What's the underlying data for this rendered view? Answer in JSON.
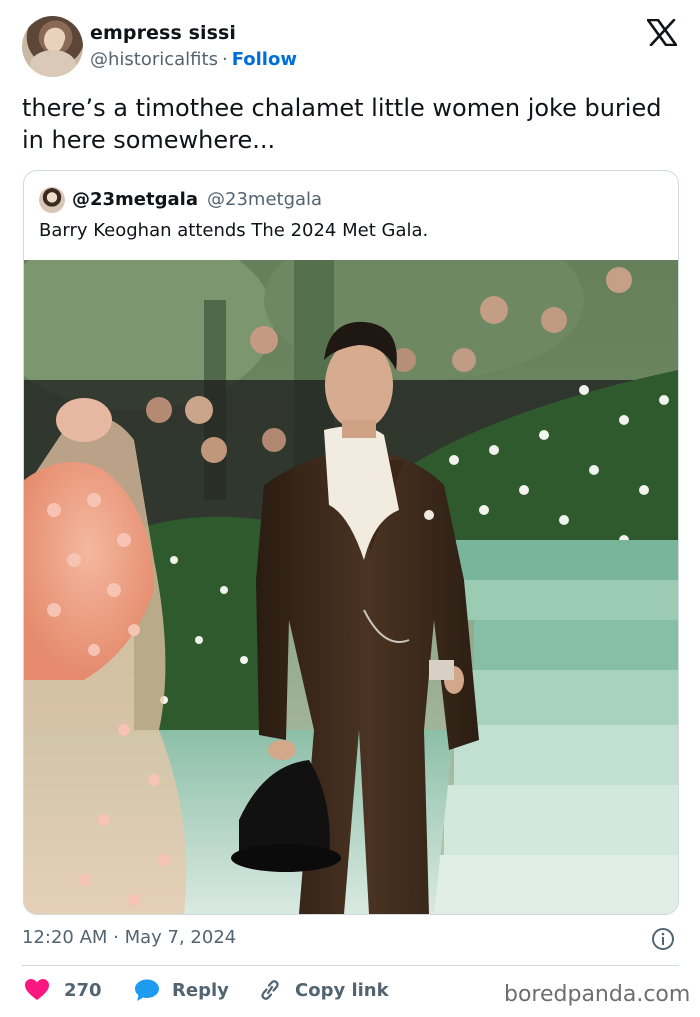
{
  "author": {
    "display_name": "empress sissi",
    "handle": "@historicalfits",
    "separator": "·",
    "follow_label": "Follow"
  },
  "tweet": {
    "text": "there’s a timothee chalamet little women joke buried in here somewhere..."
  },
  "quoted": {
    "display_name": "@23metgala",
    "handle": "@23metgala",
    "text": "Barry Keoghan attends The 2024 Met Gala."
  },
  "meta": {
    "timestamp": "12:20 AM · May 7, 2024"
  },
  "actions": {
    "like_count": "270",
    "reply_label": "Reply",
    "copy_label": "Copy link"
  },
  "watermark": "boredpanda.com",
  "colors": {
    "follow": "#006fd6",
    "like": "#f91880",
    "reply": "#1d9bf0",
    "muted": "#536471",
    "border": "#cfd9de"
  },
  "icons": [
    "x-logo-icon",
    "info-icon",
    "heart-icon",
    "reply-bubble-icon",
    "link-icon"
  ]
}
